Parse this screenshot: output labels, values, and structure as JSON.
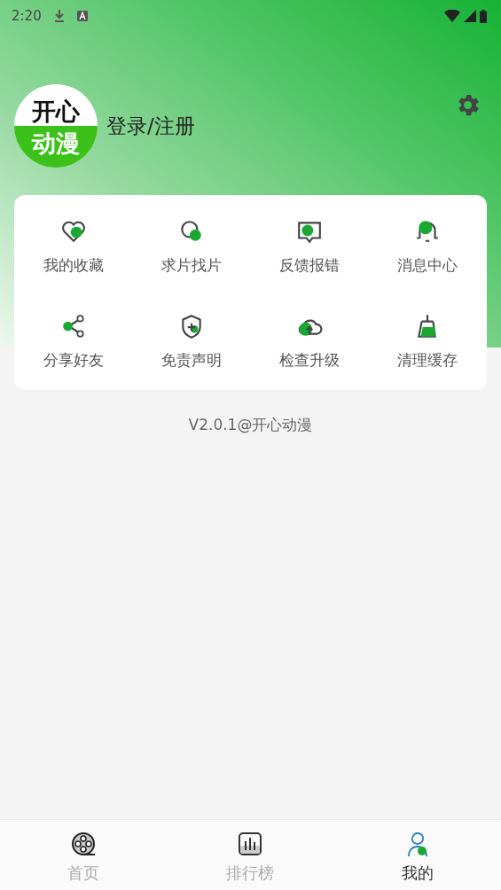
{
  "status_bar": {
    "time": "2:20"
  },
  "profile": {
    "logo_top": "开心",
    "logo_bottom": "动漫",
    "login": "登录/注册"
  },
  "menu": [
    {
      "label": "我的收藏"
    },
    {
      "label": "求片找片"
    },
    {
      "label": "反馈报错"
    },
    {
      "label": "消息中心"
    },
    {
      "label": "分享好友"
    },
    {
      "label": "免责声明"
    },
    {
      "label": "检查升级"
    },
    {
      "label": "清理缓存"
    }
  ],
  "version": "V2.0.1@开心动漫",
  "tabs": [
    {
      "label": "首页",
      "selected": false
    },
    {
      "label": "排行榜",
      "selected": false
    },
    {
      "label": "我的",
      "selected": true
    }
  ]
}
